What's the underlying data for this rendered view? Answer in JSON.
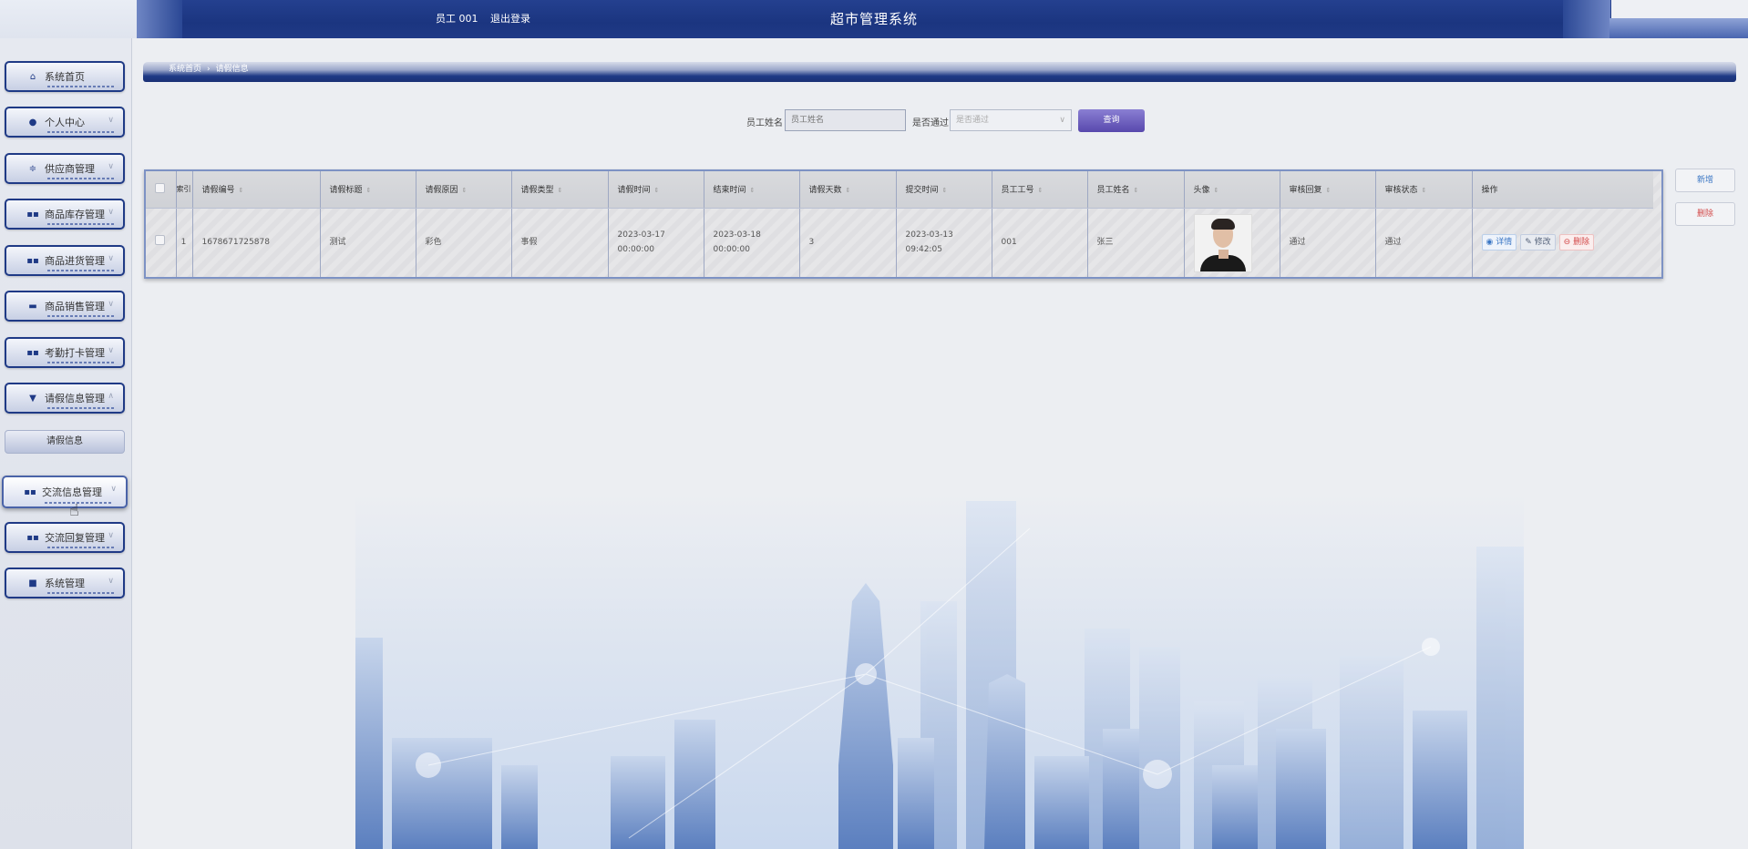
{
  "header": {
    "app_title": "超市管理系统",
    "user_label": "员工 001",
    "logout_label": "退出登录"
  },
  "sidebar": {
    "items": [
      {
        "label": "系统首页",
        "icon": "home-icon"
      },
      {
        "label": "个人中心",
        "icon": "user-icon"
      },
      {
        "label": "供应商管理",
        "icon": "sliders-icon"
      },
      {
        "label": "商品库存管理",
        "icon": "grid-icon"
      },
      {
        "label": "商品进货管理",
        "icon": "grid-icon"
      },
      {
        "label": "商品销售管理",
        "icon": "chat-icon"
      },
      {
        "label": "考勤打卡管理",
        "icon": "grid-icon"
      },
      {
        "label": "请假信息管理",
        "icon": "flag-icon"
      },
      {
        "label": "交流信息管理",
        "icon": "grid-icon"
      },
      {
        "label": "交流回复管理",
        "icon": "grid-icon"
      },
      {
        "label": "系统管理",
        "icon": "briefcase-icon"
      }
    ],
    "submenu": {
      "label": "请假信息"
    }
  },
  "breadcrumb": {
    "home": "系统首页",
    "separator": "›",
    "current": "请假信息"
  },
  "search": {
    "name_label": "员工姓名",
    "name_placeholder": "员工姓名",
    "pass_label": "是否通过",
    "pass_placeholder": "是否通过",
    "query_button": "查询"
  },
  "actions": {
    "add": "新增",
    "delete": "删除"
  },
  "table": {
    "headers": [
      "索引",
      "请假编号",
      "请假标题",
      "请假原因",
      "请假类型",
      "请假时间",
      "结束时间",
      "请假天数",
      "提交时间",
      "员工工号",
      "员工姓名",
      "头像",
      "审核回复",
      "审核状态",
      "操作"
    ],
    "rows": [
      {
        "index": "1",
        "leave_no": "1678671725878",
        "title": "测试",
        "reason": "彩色",
        "type": "事假",
        "start_time": "2023-03-17 00:00:00",
        "end_time": "2023-03-18 00:00:00",
        "days": "3",
        "submit_time": "2023-03-13 09:42:05",
        "emp_no": "001",
        "emp_name": "张三",
        "reply": "通过",
        "status": "通过"
      }
    ],
    "op_detail": "详情",
    "op_edit": "修改",
    "op_delete": "删除"
  },
  "colors": {
    "primary": "#1f3a86",
    "accent": "#5848ad",
    "danger": "#d34a4a"
  }
}
